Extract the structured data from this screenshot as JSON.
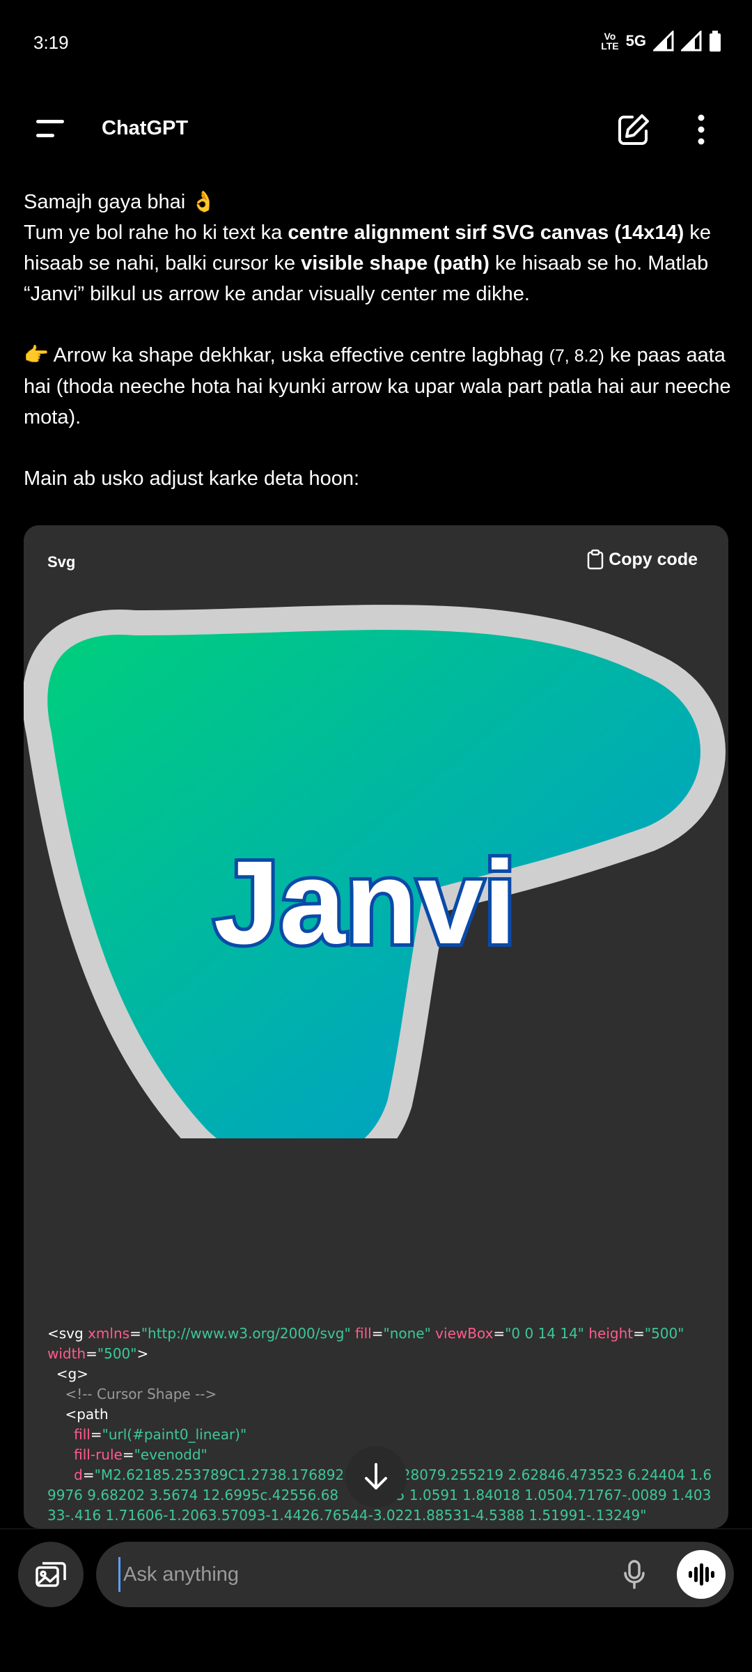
{
  "status_bar": {
    "time": "3:19",
    "network_volte": "Vo\nLTE",
    "network_5g": "5G"
  },
  "header": {
    "title": "ChatGPT"
  },
  "message": {
    "line1": "Samajh gaya bhai 👌",
    "p1_a": "Tum ye bol rahe ho ki text ka ",
    "p1_b": "centre alignment sirf SVG canvas (14x14)",
    "p1_c": " ke hisaab se nahi, balki cursor ke ",
    "p1_d": "visible shape (path)",
    "p1_e": " ke hisaab se ho. Matlab “Janvi” bilkul us arrow ke andar visually center me dikhe.",
    "p2_a": "👉 Arrow ka shape dekhkar, uska effective centre lagbhag ",
    "p2_b": "(7, 8.2)",
    "p2_c": " ke paas aata hai (thoda neeche hota hai kyunki arrow ka upar wala part patla hai aur neeche mota).",
    "p3": "Main ab usko adjust karke deta hoon:"
  },
  "code_block": {
    "language": "Svg",
    "copy_label": "Copy code",
    "preview_text": "Janvi",
    "code": {
      "t1": "<svg ",
      "a1": "xmlns",
      "s1": "\"http://www.w3.org/2000/svg\"",
      "a2": " fill",
      "s2": "\"none\"",
      "a3": " viewBox",
      "s3": "\"0 0 14 14\"",
      "a4": " height",
      "s4": "\"500\"",
      "a5": "width",
      "s5": "\"500\"",
      "t2": ">",
      "t3": "  <g>",
      "c1": "    <!-- Cursor Shape -->",
      "t4": "    <path",
      "a6": "      fill",
      "s6": "\"url(#paint0_linear)\"",
      "a7": "      fill-rule",
      "s7": "\"evenodd\"",
      "a8": "      d",
      "s8": "\"M2.62185.253789C1.2738.176892.1          28079.255219 2.62846.473523 6.24404 1.69976 9.68202 3.5674 12.6995c.42556.68         515 1.0591 1.84018 1.0504.71767-.0089 1.40333-.416 1.71606-1.2063.57093-1.4426.76544-3.0221.88531-4.5388 1.51991-.13249\""
    }
  },
  "composer": {
    "placeholder": "Ask anything"
  },
  "colors": {
    "background": "#000000",
    "code_bg": "#2f2f2f",
    "gradient_start": "#00d07a",
    "gradient_end": "#0095d8",
    "outline": "#cfcfcf",
    "text_outline": "#0a4aa8",
    "attr": "#ff5c8d",
    "string": "#3ec79b"
  }
}
